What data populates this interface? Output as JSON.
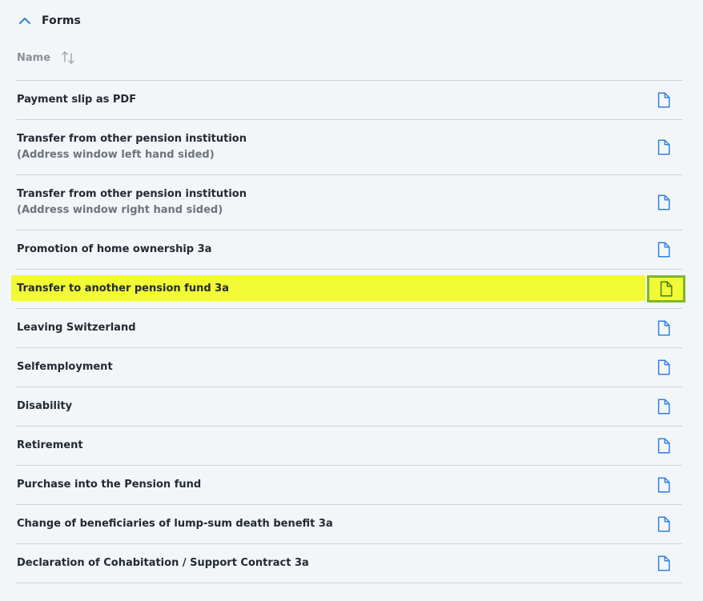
{
  "section": {
    "title": "Forms",
    "icon": "chevron-up-icon",
    "accent": "#2f7fe0"
  },
  "table": {
    "column_name": "Name",
    "sort_icon": "sort-icon"
  },
  "rows": [
    {
      "label": "Payment slip as PDF",
      "sub": ""
    },
    {
      "label": "Transfer from other pension institution",
      "sub": "(Address window left hand sided)"
    },
    {
      "label": "Transfer from other pension institution",
      "sub": "(Address window right hand sided)"
    },
    {
      "label": "Promotion of home ownership 3a",
      "sub": ""
    },
    {
      "label": "Transfer to another pension fund 3a",
      "sub": "",
      "highlighted": true
    },
    {
      "label": "Leaving Switzerland",
      "sub": ""
    },
    {
      "label": "Selfemployment",
      "sub": ""
    },
    {
      "label": "Disability",
      "sub": ""
    },
    {
      "label": "Retirement",
      "sub": ""
    },
    {
      "label": "Purchase into the Pension fund",
      "sub": ""
    },
    {
      "label": "Change of beneficiaries of lump-sum death benefit 3a",
      "sub": ""
    },
    {
      "label": "Declaration of Cohabitation / Support Contract 3a",
      "sub": ""
    }
  ],
  "colors": {
    "highlight": "#f2f935",
    "highlight_border": "#7cb82b",
    "doc_icon": "#2f7fe0",
    "doc_icon_highlight": "#3f7d1e"
  }
}
